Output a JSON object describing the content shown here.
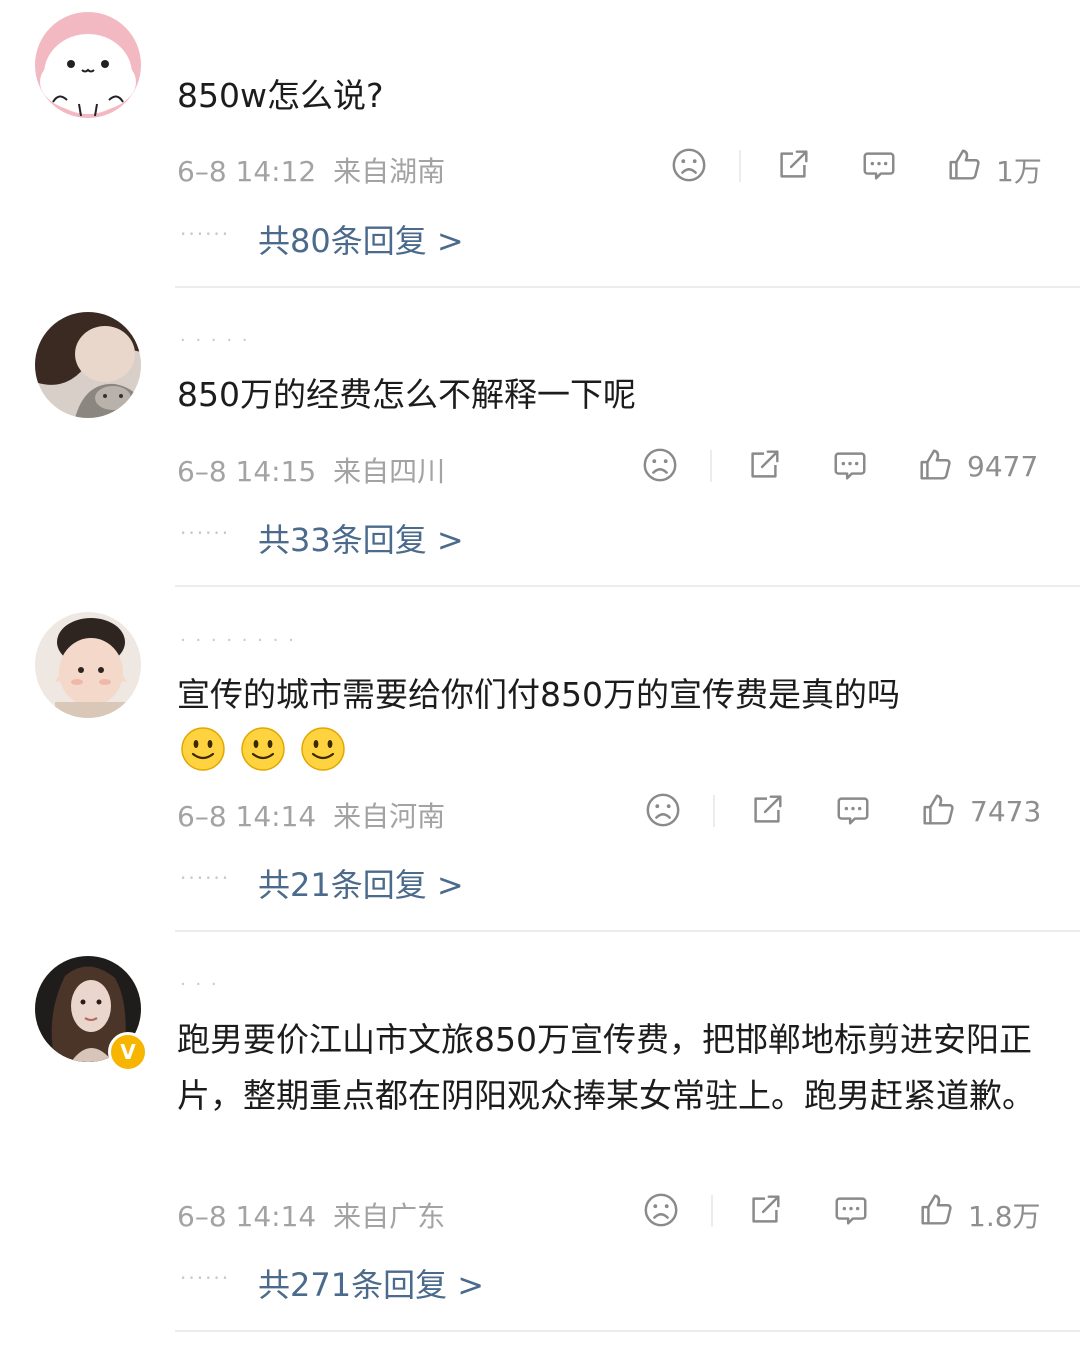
{
  "comments": [
    {
      "username": "",
      "text": "850w怎么说?",
      "time": "6–8 14:12",
      "location": "来自湖南",
      "likes": "1万",
      "replies": "共80条回复 >"
    },
    {
      "username": "· · · · ·",
      "text": "850万的经费怎么不解释一下呢",
      "time": "6–8 14:15",
      "location": "来自四川",
      "likes": "9477",
      "replies": "共33条回复 >"
    },
    {
      "username": "· · · · · · · ·",
      "text": "宣传的城市需要给你们付850万的宣传费是真的吗",
      "emojis": [
        "smile-emoji",
        "smile-emoji",
        "smile-emoji"
      ],
      "time": "6–8 14:14",
      "location": "来自河南",
      "likes": "7473",
      "replies": "共21条回复 >"
    },
    {
      "username": "· · ·",
      "text": "跑男要价江山市文旅850万宣传费，把邯郸地标剪进安阳正片，整期重点都在阴阳观众捧某女常驻上。跑男赶紧道歉。",
      "time": "6–8 14:14",
      "location": "来自广东",
      "likes": "1.8万",
      "replies": "共271条回复 >",
      "verified_badge": "V"
    }
  ],
  "colors": {
    "reply_link": "#4b6a8c",
    "meta_text": "#a3a3a3",
    "verified": "#f7b500"
  },
  "icons": [
    "sad-face-icon",
    "share-icon",
    "comment-icon",
    "thumbs-up-icon"
  ]
}
